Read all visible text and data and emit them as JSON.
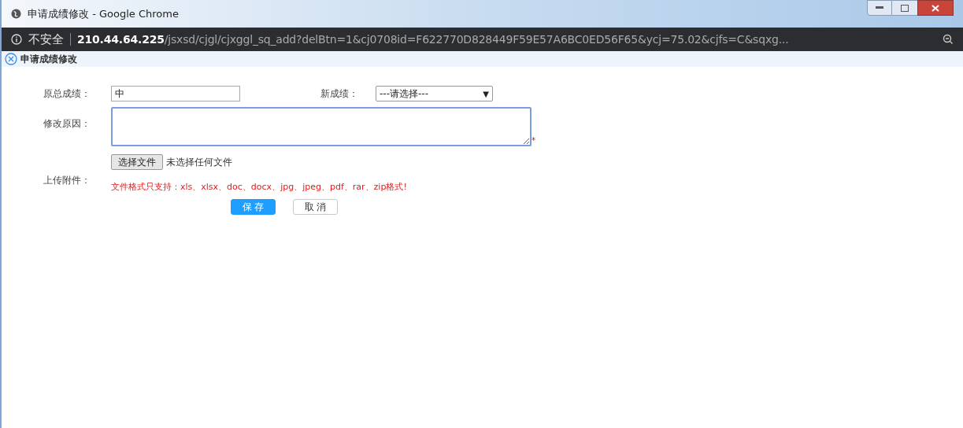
{
  "window": {
    "title": "申请成绩修改 - Google Chrome"
  },
  "address_bar": {
    "security": "不安全",
    "host": "210.44.64.225",
    "path": "/jsxsd/cjgl/cjxggl_sq_add?delBtn=1&cj0708id=F622770D828449F59E57A6BC0ED56F65&ycj=75.02&cjfs=C&sqxg..."
  },
  "page_tab": {
    "title": "申请成绩修改"
  },
  "form": {
    "original_label": "原总成绩：",
    "original_value": "中",
    "new_label": "新成绩：",
    "new_select": "---请选择---",
    "new_select_caret": "▼",
    "reason_label": "修改原因：",
    "required_mark": "*",
    "upload_label": "上传附件：",
    "file_button": "选择文件",
    "file_status": "未选择任何文件",
    "format_note": "文件格式只支持：xls、xlsx、doc、docx、jpg、jpeg、pdf、rar、zip格式!"
  },
  "buttons": [
    {
      "label": "保 存",
      "kind": "primary"
    },
    {
      "label": "取 消",
      "kind": "secondary"
    }
  ]
}
